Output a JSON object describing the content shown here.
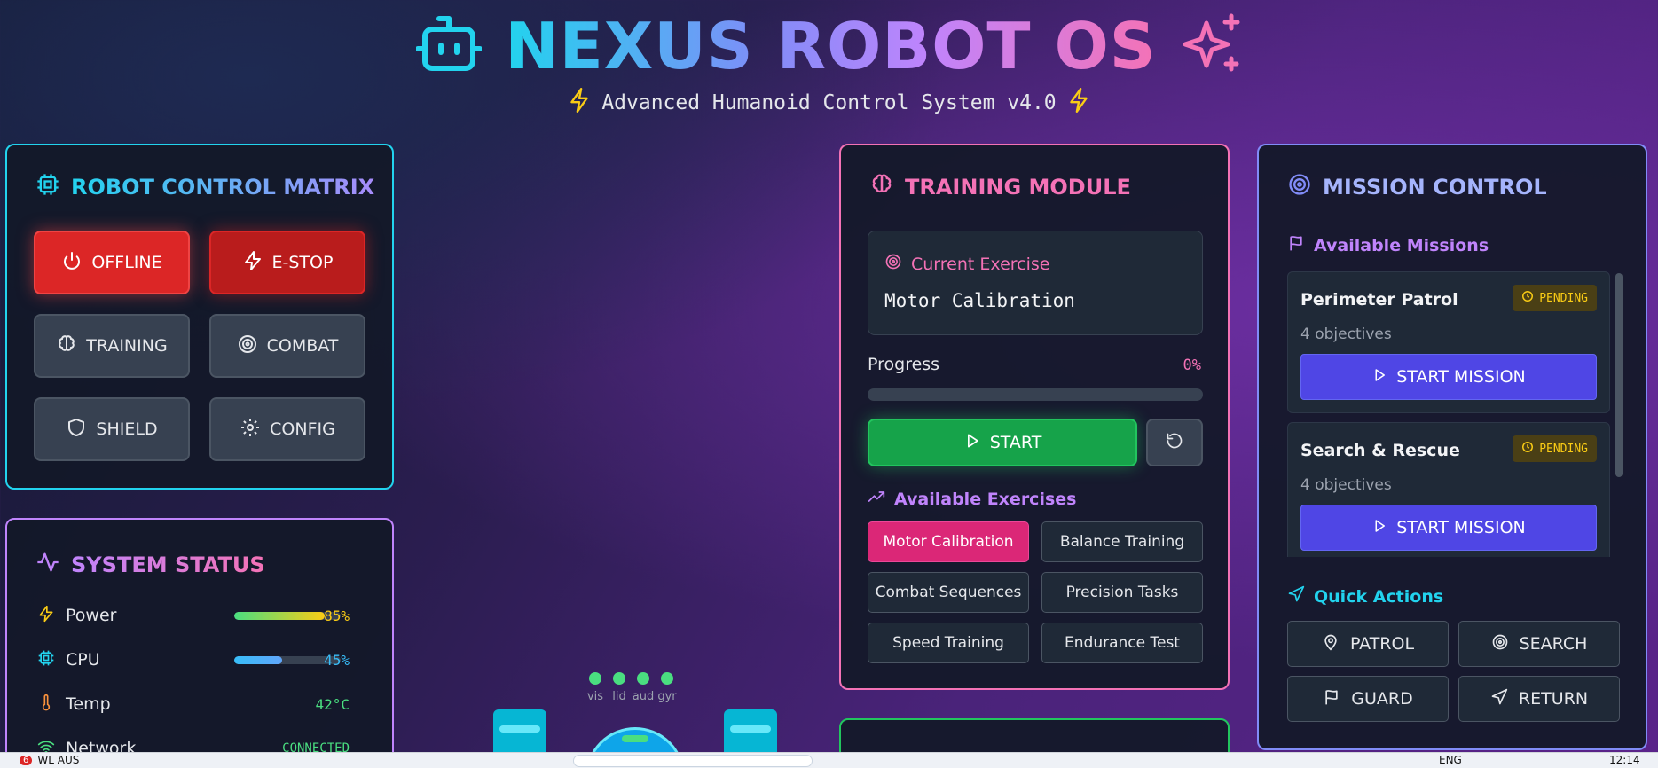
{
  "header": {
    "title": "NEXUS ROBOT OS",
    "subtitle": "Advanced Humanoid Control System v4.0"
  },
  "control_matrix": {
    "title": "ROBOT CONTROL MATRIX",
    "buttons": [
      {
        "label": "OFFLINE",
        "icon": "power-icon"
      },
      {
        "label": "E-STOP",
        "icon": "bolt-icon"
      },
      {
        "label": "TRAINING",
        "icon": "brain-icon"
      },
      {
        "label": "COMBAT",
        "icon": "target-icon"
      },
      {
        "label": "SHIELD",
        "icon": "shield-icon"
      },
      {
        "label": "CONFIG",
        "icon": "gear-icon"
      }
    ]
  },
  "system_status": {
    "title": "SYSTEM STATUS",
    "rows": [
      {
        "label": "Power",
        "value": "85%",
        "fraction": 0.85,
        "color": "#facc15"
      },
      {
        "label": "CPU",
        "value": "45%",
        "fraction": 0.45,
        "color": "#38bdf8"
      },
      {
        "label": "Temp",
        "value": "42°C",
        "color": "#4ade80"
      },
      {
        "label": "Network",
        "value": "CONNECTED",
        "color": "#4ade80"
      }
    ]
  },
  "robot_view": {
    "sensors": [
      "vis",
      "lid",
      "aud",
      "gyr"
    ]
  },
  "training": {
    "title": "TRAINING MODULE",
    "current_label": "Current Exercise",
    "current_exercise": "Motor Calibration",
    "progress_label": "Progress",
    "progress_value": "0%",
    "progress_fraction": 0,
    "start_label": "START",
    "available_label": "Available Exercises",
    "exercises": [
      "Motor Calibration",
      "Balance Training",
      "Combat Sequences",
      "Precision Tasks",
      "Speed Training",
      "Endurance Test"
    ],
    "active_exercise": "Motor Calibration"
  },
  "mission": {
    "title": "MISSION CONTROL",
    "available_label": "Available Missions",
    "missions": [
      {
        "name": "Perimeter Patrol",
        "status": "PENDING",
        "objectives": "4 objectives",
        "action": "START MISSION"
      },
      {
        "name": "Search & Rescue",
        "status": "PENDING",
        "objectives": "4 objectives",
        "action": "START MISSION"
      }
    ],
    "quick_actions_label": "Quick Actions",
    "quick_actions": [
      {
        "label": "PATROL",
        "icon": "pin-icon"
      },
      {
        "label": "SEARCH",
        "icon": "target-icon"
      },
      {
        "label": "GUARD",
        "icon": "flag-icon"
      },
      {
        "label": "RETURN",
        "icon": "navigate-icon"
      }
    ]
  },
  "taskbar": {
    "weather": "WL AUS",
    "badge": "6",
    "lang": "ENG",
    "time": "12:14"
  },
  "colors": {
    "cyan": "#22d3ee",
    "pink": "#f472b6",
    "purple": "#c084fc",
    "indigo": "#818cf8"
  }
}
